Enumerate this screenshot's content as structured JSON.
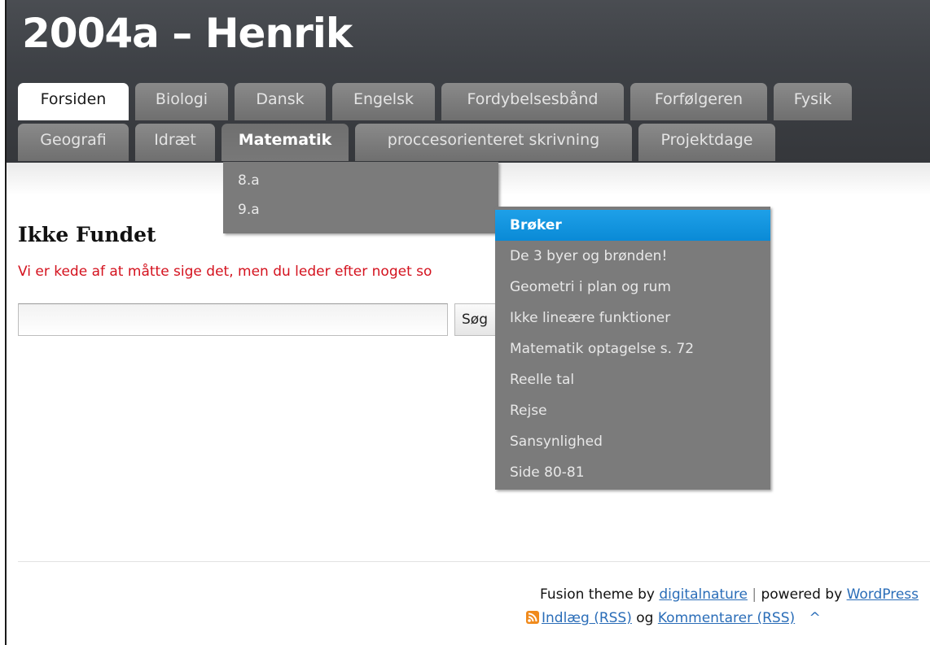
{
  "site": {
    "title": "2004a – Henrik"
  },
  "nav": {
    "row1": [
      {
        "label": "Forsiden"
      },
      {
        "label": "Biologi"
      },
      {
        "label": "Dansk"
      },
      {
        "label": "Engelsk"
      },
      {
        "label": "Fordybelsesbånd"
      },
      {
        "label": "Forfølgeren"
      },
      {
        "label": "Fysik"
      }
    ],
    "row2": [
      {
        "label": "Geografi"
      },
      {
        "label": "Idræt"
      },
      {
        "label": "Matematik"
      },
      {
        "label": "proccesorienteret skrivning"
      },
      {
        "label": "Projektdage"
      }
    ],
    "matematik_submenu": [
      {
        "label": "8.a"
      },
      {
        "label": "9.a"
      }
    ],
    "flyout_submenu": [
      {
        "label": "Brøker"
      },
      {
        "label": "De 3 byer og brønden!"
      },
      {
        "label": "Geometri i plan og rum"
      },
      {
        "label": "Ikke lineære funktioner"
      },
      {
        "label": "Matematik optagelse s. 72"
      },
      {
        "label": "Reelle tal"
      },
      {
        "label": "Rejse"
      },
      {
        "label": "Sansynlighed"
      },
      {
        "label": "Side 80-81"
      }
    ]
  },
  "main": {
    "heading": "Ikke Fundet",
    "message": "Vi er kede af at måtte sige det, men du leder efter noget so",
    "search": {
      "value": "",
      "button_label": "Søg"
    }
  },
  "footer": {
    "theme_prefix": "Fusion theme by",
    "theme_author": "digitalnature",
    "separator": "|",
    "powered_prefix": "powered by",
    "powered_by": "WordPress",
    "rss_posts": "Indlæg (RSS)",
    "og": "og",
    "rss_comments": "Kommentarer (RSS)",
    "top_arrow": "^"
  },
  "colors": {
    "header_bg": "#3e4146",
    "tab_bg": "#7b7b7b",
    "highlight": "#1ea0e8",
    "error_text": "#d4121e",
    "link": "#2a6db8"
  }
}
